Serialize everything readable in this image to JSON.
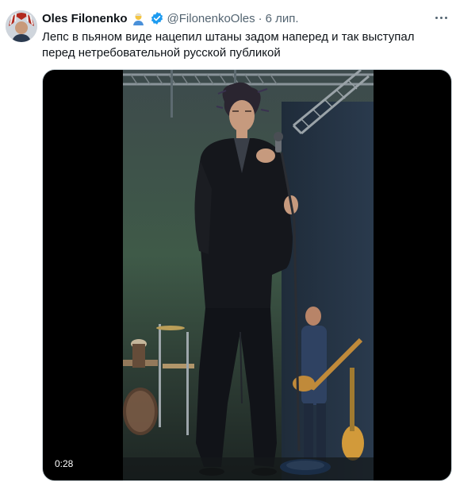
{
  "tweet": {
    "author_name": "Oles Filonenko",
    "handle": "@FilonenkoOles",
    "separator": "·",
    "time": "6 лип.",
    "text": "Лепс в пьяном виде нацепил штаны задом наперед и так выступал перед нетребовательной русской публикой",
    "icons": {
      "emoji": "man-emoji-icon",
      "verified": "verified-badge-icon",
      "more": "more-options-icon"
    },
    "media": {
      "duration": "0:28"
    }
  },
  "colors": {
    "verified": "#1d9bf0",
    "secondary_text": "#536471",
    "primary_text": "#0f1419"
  }
}
